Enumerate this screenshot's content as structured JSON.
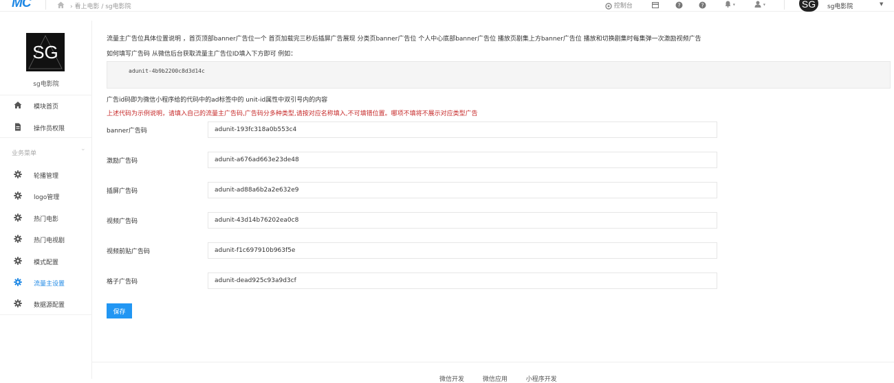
{
  "topbar": {
    "logo": "MC",
    "breadcrumb": "看上电影 / sg电影院",
    "console_label": "控制台",
    "user_avatar_text": "SG",
    "user_name": "sg电影院"
  },
  "sidebar": {
    "logo_text": "SG",
    "site_name": "sg电影院",
    "items_top": [
      {
        "label": "模块首页",
        "icon": "home-icon"
      },
      {
        "label": "操作员权限",
        "icon": "document-icon"
      }
    ],
    "group_label": "业务菜单",
    "items": [
      {
        "label": "轮播管理",
        "icon": "gear-icon"
      },
      {
        "label": "logo管理",
        "icon": "gear-icon"
      },
      {
        "label": "热门电影",
        "icon": "gear-icon"
      },
      {
        "label": "热门电视剧",
        "icon": "gear-icon"
      },
      {
        "label": "模式配置",
        "icon": "gear-icon"
      },
      {
        "label": "流量主设置",
        "icon": "gear-icon",
        "active": true
      },
      {
        "label": "数据源配置",
        "icon": "gear-icon"
      }
    ]
  },
  "main": {
    "description": "流量主广告位具体位置说明 ，首页顶部banner广告位一个 首页加载完三秒后插屏广告展现 分类页banner广告位 个人中心底部banner广告位 播放页剧集上方banner广告位 播放和切换剧集时每集弹一次激励视频广告",
    "how_to": "如何填写广告码 从微信后台获取流量主广告位ID填入下方即可 例如：",
    "code_example": "adunit-4b9b2200c8d3d14c",
    "note": "广告id码即为微信小程序给的代码中的ad标签中的 unit-id属性中双引号内的内容",
    "warning": "上述代码为示例说明，请填入自己的流量主广告码,广告码分多种类型,请按对应名称填入,不可填错位置。哪项不填将不展示对应类型广告",
    "fields": [
      {
        "label": "banner广告码",
        "value": "adunit-193fc318a0b553c4"
      },
      {
        "label": "激励广告码",
        "value": "adunit-a676ad663e23de48"
      },
      {
        "label": "插屏广告码",
        "value": "adunit-ad88a6b2a2e632e9"
      },
      {
        "label": "视频广告码",
        "value": "adunit-43d14b76202ea0c8"
      },
      {
        "label": "视频前贴广告码",
        "value": "adunit-f1c697910b963f5e"
      },
      {
        "label": "格子广告码",
        "value": "adunit-dead925c93a9d3cf"
      }
    ],
    "save_label": "保存"
  },
  "footer": {
    "links": [
      "微信开发",
      "微信应用",
      "小程序开发"
    ]
  },
  "colors": {
    "accent": "#2196f3",
    "warning": "#c62828",
    "logo_blue": "#1e88e5"
  }
}
